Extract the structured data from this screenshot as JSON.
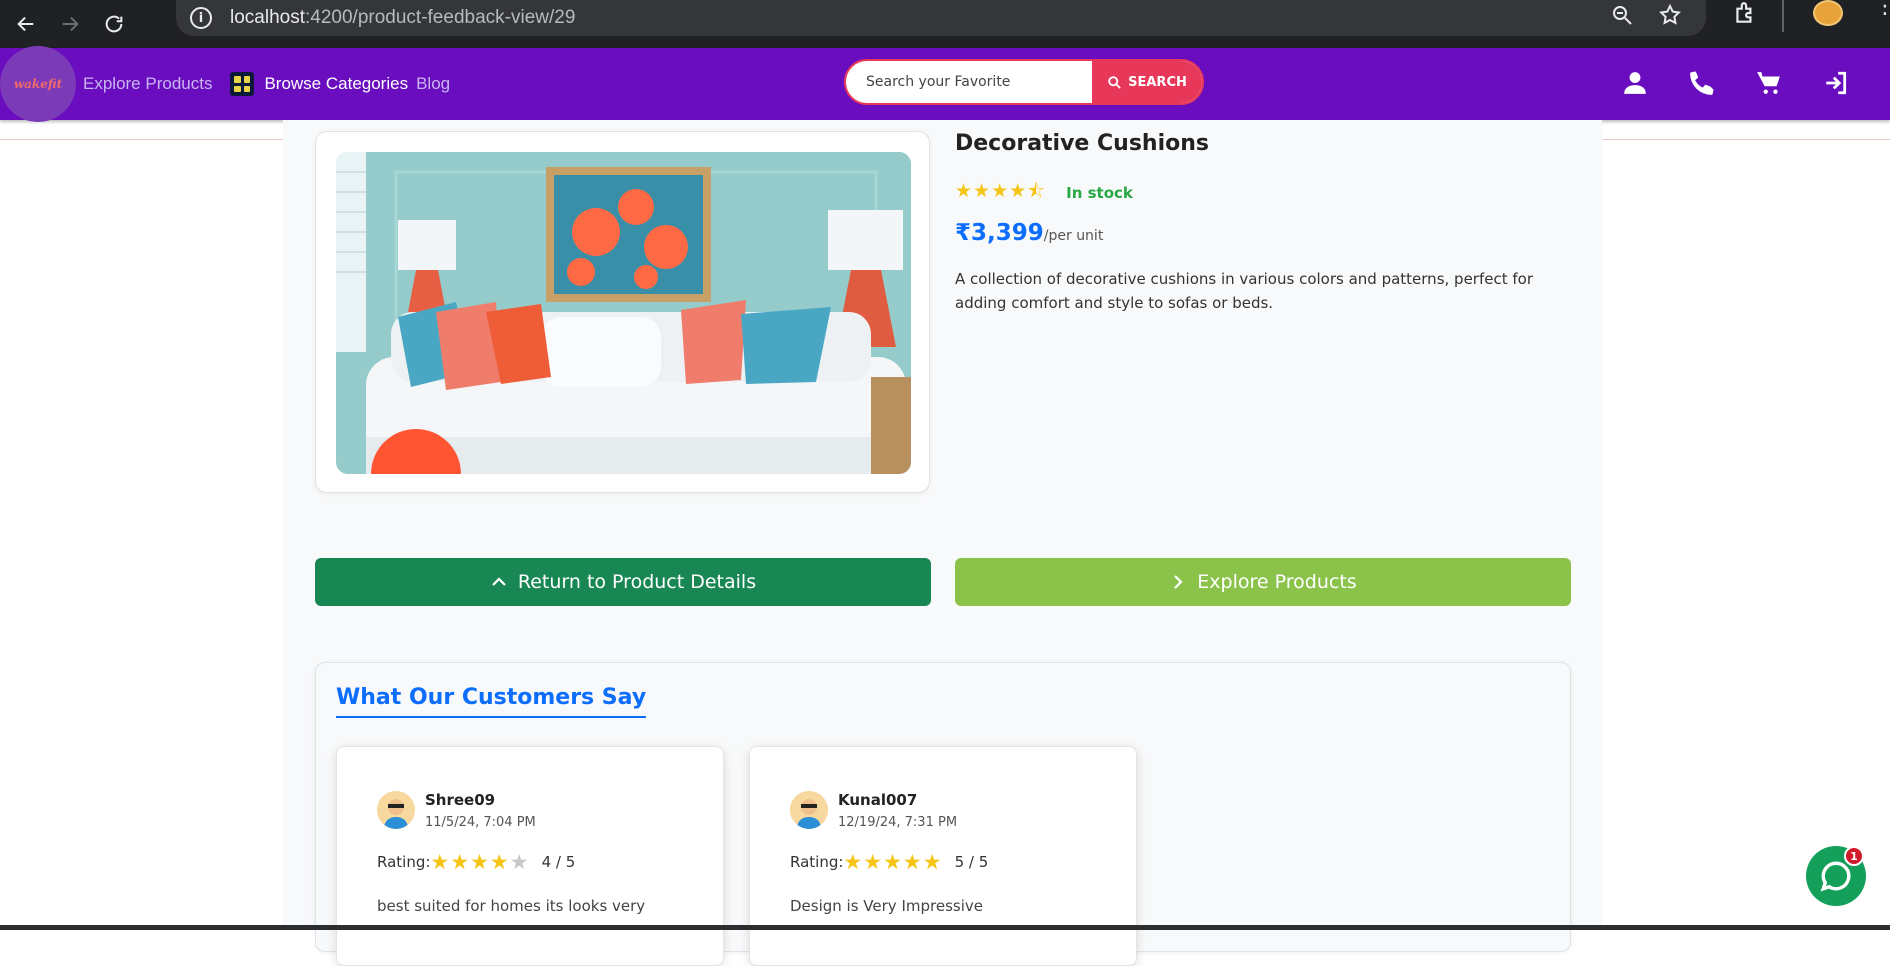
{
  "browser": {
    "url_host": "localhost",
    "url_path": ":4200/product-feedback-view/29"
  },
  "nav": {
    "logo_text": "wakefit",
    "explore_products": "Explore Products",
    "browse_categories": "Browse Categories",
    "blog": "Blog",
    "search_placeholder": "Search your Favorite",
    "search_button": "SEARCH"
  },
  "product": {
    "title": "Decorative Cushions",
    "rating": 4.5,
    "stars_display": "★★★★⯪",
    "stock": "In stock",
    "price": "₹3,399",
    "price_unit": "/per unit",
    "description": "A collection of decorative cushions in various colors and patterns, perfect for adding comfort and style to sofas or beds."
  },
  "actions": {
    "return_label": "Return to Product Details",
    "explore_label": "Explore Products"
  },
  "reviews": {
    "title": "What Our Customers Say",
    "rating_label": "Rating:",
    "items": [
      {
        "user": "Shree09",
        "date": "11/5/24, 7:04 PM",
        "rating": 4,
        "score": "4 / 5",
        "text": "best suited for homes its looks very"
      },
      {
        "user": "Kunal007",
        "date": "12/19/24, 7:31 PM",
        "rating": 5,
        "score": "5 / 5",
        "text": "Design is Very Impressive"
      }
    ]
  },
  "chat": {
    "badge": "1"
  },
  "colors": {
    "nav_bg": "#6a0dbf",
    "search_accent": "#e8385a",
    "price_blue": "#0d6efd",
    "stock_green": "#28a745",
    "return_btn": "#198754",
    "explore_btn": "#8bc34a",
    "star": "#f5c518"
  }
}
